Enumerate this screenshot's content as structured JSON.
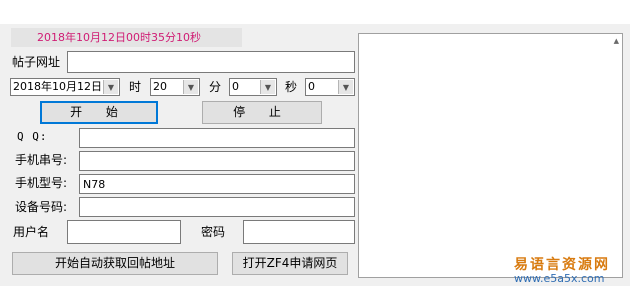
{
  "header": {
    "timestamp": "2018年10月12日00时35分10秒",
    "timestamp_color": "#d01c74"
  },
  "post_url": {
    "label": "帖子网址",
    "value": ""
  },
  "schedule": {
    "date_value": "2018年10月12日",
    "hour_label": "时",
    "hour_value": "20",
    "minute_label": "分",
    "minute_value": "0",
    "second_label": "秒",
    "second_value": "0"
  },
  "buttons": {
    "start": "开 始",
    "stop": "停 止",
    "auto_fetch": "开始自动获取回帖地址",
    "open_zf4": "打开ZF4申请网页"
  },
  "fields": {
    "qq": {
      "label": "Q Q:",
      "value": ""
    },
    "phone_serial": {
      "label": "手机串号:",
      "value": ""
    },
    "phone_model": {
      "label": "手机型号:",
      "value": "N78"
    },
    "device_id": {
      "label": "设备号码:",
      "value": ""
    },
    "username": {
      "label": "用户名",
      "value": ""
    },
    "password": {
      "label": "密码",
      "value": ""
    }
  },
  "watermark": {
    "name": "易语言资源网",
    "url": "www.e5a5x.com",
    "name_color": "#d87b10",
    "url_color": "#2f6db3"
  }
}
